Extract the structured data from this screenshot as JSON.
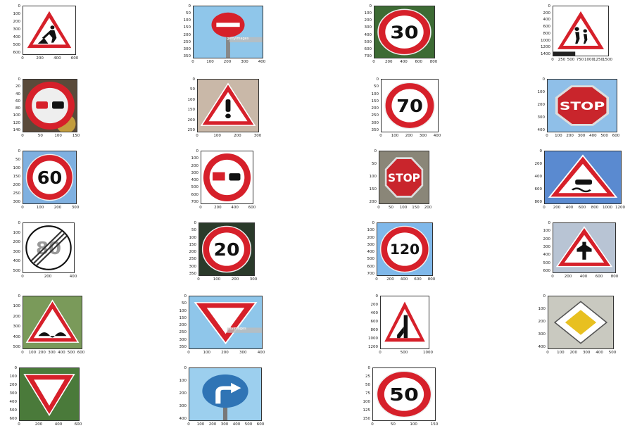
{
  "panels": [
    {
      "name": "road-works-sign",
      "yticks": [
        "0",
        "100",
        "200",
        "300",
        "400",
        "500",
        "600"
      ],
      "xticks": [
        "0",
        "200",
        "400",
        "600"
      ]
    },
    {
      "name": "no-entry-sign",
      "yticks": [
        "0",
        "50",
        "100",
        "150",
        "200",
        "250",
        "300",
        "350"
      ],
      "xticks": [
        "0",
        "100",
        "200",
        "300",
        "400"
      ],
      "watermark": "gettyimages"
    },
    {
      "name": "speed-limit-30-sign",
      "value": "30",
      "yticks": [
        "0",
        "100",
        "200",
        "300",
        "400",
        "500",
        "600",
        "700"
      ],
      "xticks": [
        "0",
        "200",
        "400",
        "600",
        "800"
      ]
    },
    {
      "name": "children-crossing-sign",
      "yticks": [
        "0",
        "200",
        "400",
        "600",
        "800",
        "1000",
        "1200",
        "1400"
      ],
      "xticks": [
        "0",
        "250",
        "500",
        "750",
        "1000",
        "1250",
        "1500"
      ]
    },
    {
      "name": "no-overtaking-sign",
      "yticks": [
        "0",
        "20",
        "40",
        "60",
        "80",
        "100",
        "120",
        "140"
      ],
      "xticks": [
        "0",
        "50",
        "100",
        "150"
      ]
    },
    {
      "name": "general-caution-sign",
      "yticks": [
        "0",
        "50",
        "100",
        "150",
        "200",
        "250"
      ],
      "xticks": [
        "0",
        "100",
        "200",
        "300"
      ]
    },
    {
      "name": "speed-limit-70-sign",
      "value": "70",
      "yticks": [
        "0",
        "50",
        "100",
        "150",
        "200",
        "250",
        "300",
        "350"
      ],
      "xticks": [
        "0",
        "100",
        "200",
        "300",
        "400"
      ]
    },
    {
      "name": "stop-sign",
      "value": "STOP",
      "yticks": [
        "0",
        "100",
        "200",
        "300",
        "400"
      ],
      "xticks": [
        "0",
        "100",
        "200",
        "300",
        "400",
        "500",
        "600"
      ]
    },
    {
      "name": "speed-limit-60-sign",
      "value": "60",
      "yticks": [
        "0",
        "50",
        "100",
        "150",
        "200",
        "250",
        "300"
      ],
      "xticks": [
        "0",
        "100",
        "200",
        "300"
      ]
    },
    {
      "name": "no-overtaking-trucks-sign",
      "yticks": [
        "0",
        "100",
        "200",
        "300",
        "400",
        "500",
        "600",
        "700"
      ],
      "xticks": [
        "0",
        "200",
        "400",
        "600"
      ]
    },
    {
      "name": "stop-sign-trees",
      "value": "STOP",
      "yticks": [
        "0",
        "50",
        "100",
        "150",
        "200"
      ],
      "xticks": [
        "0",
        "50",
        "100",
        "150",
        "200"
      ]
    },
    {
      "name": "slippery-road-sign",
      "yticks": [
        "0",
        "200",
        "400",
        "600",
        "800"
      ],
      "xticks": [
        "0",
        "200",
        "400",
        "600",
        "800",
        "1000",
        "1200"
      ]
    },
    {
      "name": "end-speed-limit-80-sign",
      "value": "80",
      "yticks": [
        "0",
        "100",
        "200",
        "300",
        "400",
        "500"
      ],
      "xticks": [
        "0",
        "200",
        "400"
      ]
    },
    {
      "name": "speed-limit-20-sign",
      "value": "20",
      "yticks": [
        "0",
        "50",
        "100",
        "150",
        "200",
        "250",
        "300",
        "350"
      ],
      "xticks": [
        "0",
        "100",
        "200",
        "300"
      ]
    },
    {
      "name": "speed-limit-120-sign",
      "value": "120",
      "yticks": [
        "0",
        "100",
        "200",
        "300",
        "400",
        "500",
        "600",
        "700"
      ],
      "xticks": [
        "0",
        "200",
        "400",
        "600",
        "800"
      ]
    },
    {
      "name": "right-of-way-sign",
      "yticks": [
        "0",
        "100",
        "200",
        "300",
        "400",
        "500",
        "600"
      ],
      "xticks": [
        "0",
        "200",
        "400",
        "600",
        "800"
      ]
    },
    {
      "name": "bumpy-road-sign",
      "yticks": [
        "0",
        "100",
        "200",
        "300",
        "400",
        "500"
      ],
      "xticks": [
        "0",
        "100",
        "200",
        "300",
        "400",
        "500",
        "600"
      ]
    },
    {
      "name": "yield-sign-sky",
      "yticks": [
        "0",
        "50",
        "100",
        "150",
        "200",
        "250",
        "300",
        "350"
      ],
      "xticks": [
        "0",
        "100",
        "200",
        "300",
        "400"
      ],
      "watermark": "gettyimages"
    },
    {
      "name": "merging-traffic-sign",
      "yticks": [
        "0",
        "200",
        "400",
        "600",
        "800",
        "1000",
        "1200"
      ],
      "xticks": [
        "0",
        "500",
        "1000"
      ]
    },
    {
      "name": "priority-road-sign",
      "yticks": [
        "0",
        "100",
        "200",
        "300",
        "400"
      ],
      "xticks": [
        "0",
        "100",
        "200",
        "300",
        "400",
        "500"
      ]
    },
    {
      "name": "yield-sign-trees",
      "yticks": [
        "0",
        "100",
        "200",
        "300",
        "400",
        "500",
        "600"
      ],
      "xticks": [
        "0",
        "200",
        "400",
        "600"
      ]
    },
    {
      "name": "turn-right-ahead-sign",
      "yticks": [
        "0",
        "100",
        "200",
        "300",
        "400"
      ],
      "xticks": [
        "0",
        "100",
        "200",
        "300",
        "400",
        "500",
        "600"
      ]
    },
    {
      "name": "speed-limit-50-sign",
      "value": "50",
      "yticks": [
        "0",
        "25",
        "50",
        "75",
        "100",
        "125",
        "150"
      ],
      "xticks": [
        "0",
        "50",
        "100",
        "150"
      ]
    }
  ]
}
